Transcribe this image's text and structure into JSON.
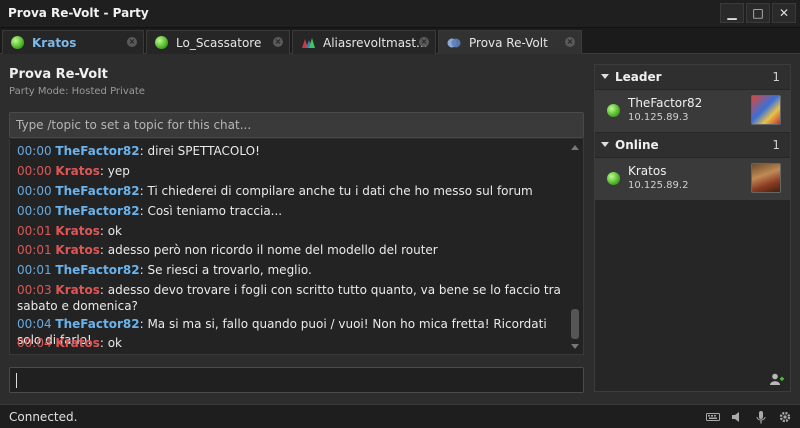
{
  "window": {
    "title": "Prova Re-Volt - Party"
  },
  "window_controls": {
    "minimize": "▁",
    "maximize": "□",
    "close": "✕"
  },
  "tabs": [
    {
      "label": "Kratos",
      "icon": "online-status-icon"
    },
    {
      "label": "Lo_Scassatore",
      "icon": "online-status-icon"
    },
    {
      "label": "Aliasrevoltmast...",
      "icon": "group-icon"
    },
    {
      "label": "Prova Re-Volt",
      "icon": "party-icon"
    }
  ],
  "party": {
    "title": "Prova Re-Volt",
    "mode": "Party Mode: Hosted Private"
  },
  "chat": {
    "topic_placeholder": "Type /topic to set a topic for this chat...",
    "messages": [
      {
        "time": "00:00",
        "nick": "TheFactor82",
        "text": ": direi SPETTACOLO!"
      },
      {
        "time": "00:00",
        "nick": "Kratos",
        "text": ": yep"
      },
      {
        "time": "00:00",
        "nick": "TheFactor82",
        "text": ": Ti chiederei di compilare anche tu i dati che ho messo sul forum"
      },
      {
        "time": "00:00",
        "nick": "TheFactor82",
        "text": ": Così teniamo traccia..."
      },
      {
        "time": "00:01",
        "nick": "Kratos",
        "text": ": ok"
      },
      {
        "time": "00:01",
        "nick": "Kratos",
        "text": ": adesso però non ricordo il nome del modello del router"
      },
      {
        "time": "00:01",
        "nick": "TheFactor82",
        "text": ": Se riesci a trovarlo, meglio."
      },
      {
        "time": "00:03",
        "nick": "Kratos",
        "text": ": adesso devo trovare i fogli con scritto tutto quanto, va bene se lo faccio tra sabato e domenica?"
      },
      {
        "time": "00:04",
        "nick": "TheFactor82",
        "text": ": Ma si ma si, fallo quando puoi / vuoi! Non ho mica fretta! Ricordati solo di farlo!"
      },
      {
        "time": "00:04",
        "nick": "Kratos",
        "text": ": ok"
      }
    ],
    "input_value": ""
  },
  "roster": {
    "groups": [
      {
        "name": "Leader",
        "count": "1",
        "members": [
          {
            "name": "TheFactor82",
            "ip": "10.125.89.3"
          }
        ]
      },
      {
        "name": "Online",
        "count": "1",
        "members": [
          {
            "name": "Kratos",
            "ip": "10.125.89.2"
          }
        ]
      }
    ]
  },
  "status": {
    "text": "Connected."
  },
  "colors": {
    "nick_blue": "#6ab3ec",
    "nick_red": "#e05656",
    "online_green": "#3fa51b"
  }
}
